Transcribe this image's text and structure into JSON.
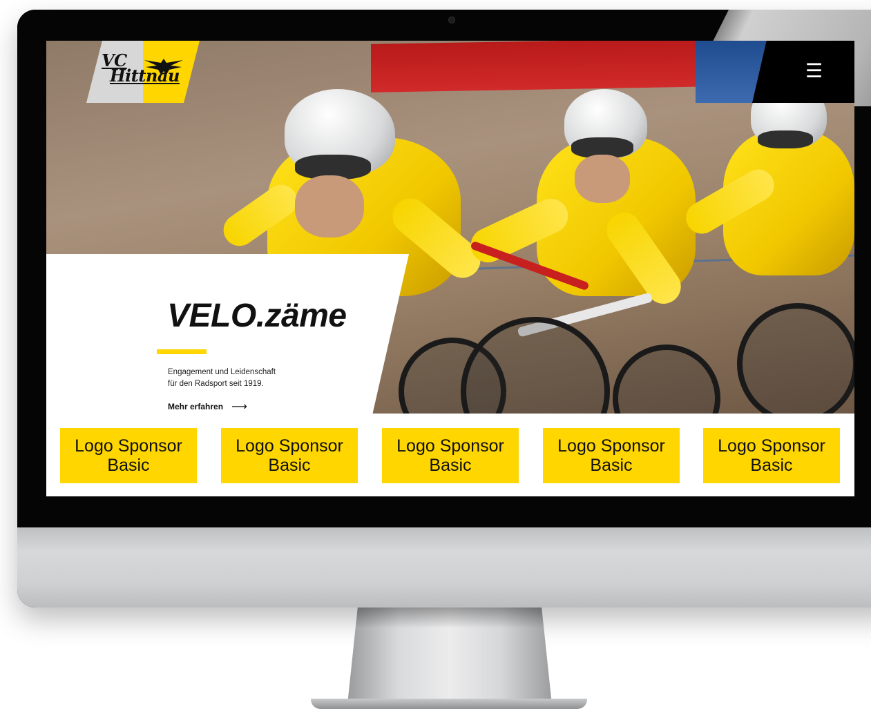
{
  "header": {
    "logo_line1": "VC",
    "logo_line2": "Hittnau",
    "menu_icon": "hamburger-menu-icon"
  },
  "hero": {
    "headline": "VELO.zäme",
    "tagline_line1": "Engagement und Leidenschaft",
    "tagline_line2": "für den Radsport seit 1919.",
    "cta_label": "Mehr erfahren",
    "cta_arrow": "⟶",
    "image_description_icon": "track-cyclists-photo"
  },
  "sponsors": [
    {
      "line1": "Logo Sponsor",
      "line2": "Basic"
    },
    {
      "line1": "Logo Sponsor",
      "line2": "Basic"
    },
    {
      "line1": "Logo Sponsor",
      "line2": "Basic"
    },
    {
      "line1": "Logo Sponsor",
      "line2": "Basic"
    },
    {
      "line1": "Logo Sponsor",
      "line2": "Basic"
    }
  ],
  "colors": {
    "brand_yellow": "#ffd600",
    "text_dark": "#111111",
    "menu_bg": "#000000",
    "logo_grey": "#d7d7d7"
  }
}
